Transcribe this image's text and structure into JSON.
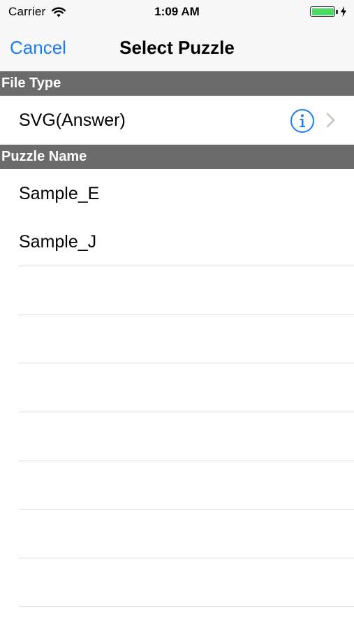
{
  "status_bar": {
    "carrier": "Carrier",
    "time": "1:09 AM",
    "battery_level": 1.0,
    "icons": [
      "wifi-icon",
      "battery-icon",
      "charging-bolt-icon"
    ]
  },
  "nav": {
    "cancel_label": "Cancel",
    "title": "Select Puzzle"
  },
  "sections": {
    "file_type": {
      "header": "File Type",
      "row_label": "SVG(Answer)",
      "icons": [
        "info-icon",
        "chevron-right-icon"
      ]
    },
    "puzzle_name": {
      "header": "Puzzle Name",
      "items": [
        "Sample_E",
        "Sample_J"
      ]
    }
  },
  "colors": {
    "accent": "#1a7df5",
    "section_header_bg": "#6b6b6b",
    "battery_green": "#4cd964",
    "separator": "#dcdcdc"
  }
}
